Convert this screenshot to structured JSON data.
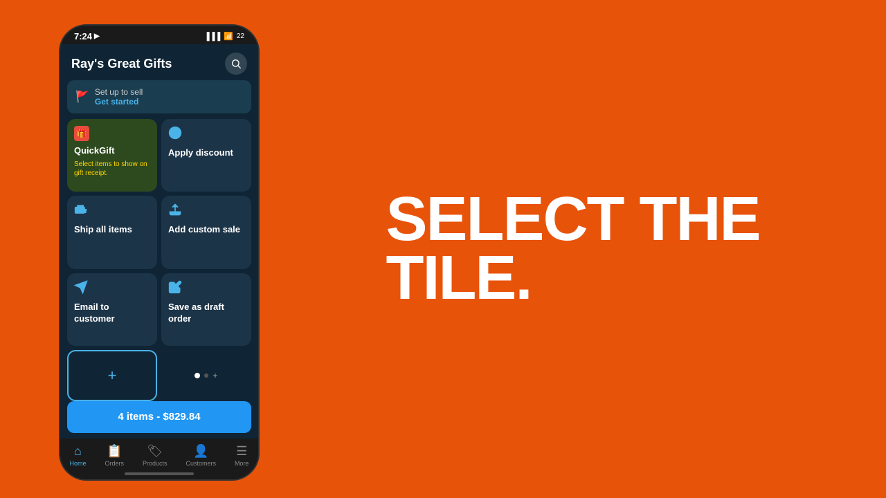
{
  "background_color": "#E8530A",
  "phone": {
    "status_bar": {
      "time": "7:24",
      "battery": "22"
    },
    "header": {
      "title": "Ray's Great Gifts",
      "search_label": "search"
    },
    "setup_banner": {
      "title": "Set up to sell",
      "link": "Get started"
    },
    "tiles": [
      {
        "id": "quickgift",
        "icon": "gift",
        "title": "QuickGift",
        "subtitle": "Select items to show on gift receipt.",
        "type": "special"
      },
      {
        "id": "apply-discount",
        "icon": "discount",
        "title": "Apply discount",
        "subtitle": ""
      },
      {
        "id": "ship-all-items",
        "icon": "ship",
        "title": "Ship all items",
        "subtitle": ""
      },
      {
        "id": "add-custom-sale",
        "icon": "upload",
        "title": "Add custom sale",
        "subtitle": ""
      },
      {
        "id": "email-to-customer",
        "icon": "send",
        "title": "Email to customer",
        "subtitle": ""
      },
      {
        "id": "save-as-draft",
        "icon": "draft",
        "title": "Save as draft order",
        "subtitle": ""
      }
    ],
    "add_tile_label": "+",
    "cart_button": {
      "label": "4 items - $829.84"
    },
    "bottom_nav": [
      {
        "id": "home",
        "label": "Home",
        "active": true
      },
      {
        "id": "orders",
        "label": "Orders",
        "active": false
      },
      {
        "id": "products",
        "label": "Products",
        "active": false
      },
      {
        "id": "customers",
        "label": "Customers",
        "active": false
      },
      {
        "id": "more",
        "label": "More",
        "active": false
      }
    ]
  },
  "hero": {
    "line1": "SELECT THE",
    "line2": "TILE."
  }
}
